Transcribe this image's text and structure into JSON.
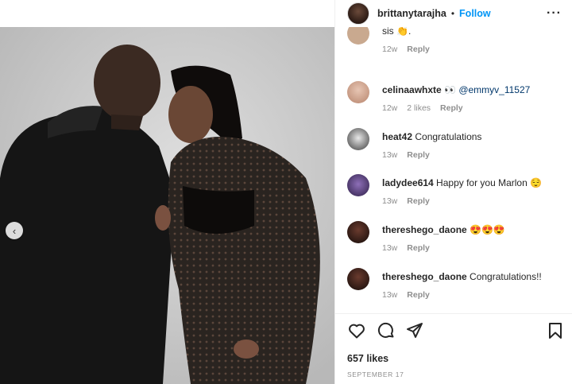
{
  "post": {
    "username": "brittanytarajha",
    "follow_label": "Follow",
    "header_dot": "•",
    "more_icon": "···",
    "likes": "657 likes",
    "date": "SEPTEMBER 17"
  },
  "comments": [
    {
      "user": "",
      "text": "sis 👏.",
      "meta": [
        "12w"
      ],
      "reply": "Reply"
    },
    {
      "user": "celinaawhxte",
      "text": " 👀 ",
      "mention": "@emmyv_11527",
      "meta": [
        "12w",
        "2 likes"
      ],
      "reply": "Reply"
    },
    {
      "user": "heat42",
      "text": " Congratulations",
      "meta": [
        "13w"
      ],
      "reply": "Reply"
    },
    {
      "user": "ladydee614",
      "text": " Happy for you Marlon 😌",
      "meta": [
        "13w"
      ],
      "reply": "Reply"
    },
    {
      "user": "thereshego_daone",
      "text": " 😍😍😍",
      "meta": [
        "13w"
      ],
      "reply": "Reply"
    },
    {
      "user": "thereshego_daone",
      "text": " Congratulations!!",
      "meta": [
        "13w"
      ],
      "reply": "Reply"
    }
  ],
  "icons": {
    "carousel_prev": "‹",
    "like": "heart-icon",
    "comment": "comment-icon",
    "share": "share-icon",
    "save": "bookmark-icon"
  },
  "colors": {
    "accent": "#0095f6",
    "muted": "#8e8e8e",
    "text": "#262626"
  }
}
